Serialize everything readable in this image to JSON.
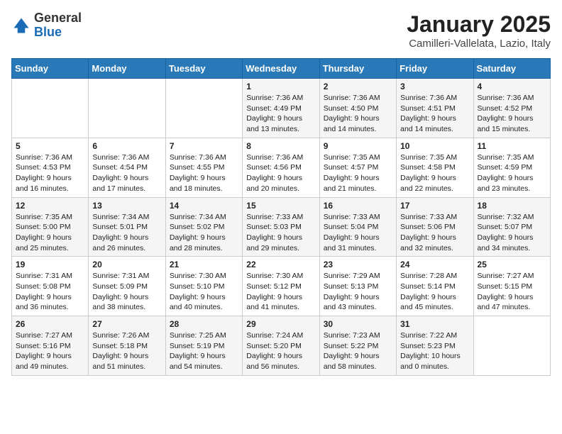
{
  "header": {
    "logo": {
      "general": "General",
      "blue": "Blue"
    },
    "title": "January 2025",
    "location": "Camilleri-Vallelata, Lazio, Italy"
  },
  "weekdays": [
    "Sunday",
    "Monday",
    "Tuesday",
    "Wednesday",
    "Thursday",
    "Friday",
    "Saturday"
  ],
  "weeks": [
    [
      {
        "day": "",
        "info": ""
      },
      {
        "day": "",
        "info": ""
      },
      {
        "day": "",
        "info": ""
      },
      {
        "day": "1",
        "info": "Sunrise: 7:36 AM\nSunset: 4:49 PM\nDaylight: 9 hours\nand 13 minutes."
      },
      {
        "day": "2",
        "info": "Sunrise: 7:36 AM\nSunset: 4:50 PM\nDaylight: 9 hours\nand 14 minutes."
      },
      {
        "day": "3",
        "info": "Sunrise: 7:36 AM\nSunset: 4:51 PM\nDaylight: 9 hours\nand 14 minutes."
      },
      {
        "day": "4",
        "info": "Sunrise: 7:36 AM\nSunset: 4:52 PM\nDaylight: 9 hours\nand 15 minutes."
      }
    ],
    [
      {
        "day": "5",
        "info": "Sunrise: 7:36 AM\nSunset: 4:53 PM\nDaylight: 9 hours\nand 16 minutes."
      },
      {
        "day": "6",
        "info": "Sunrise: 7:36 AM\nSunset: 4:54 PM\nDaylight: 9 hours\nand 17 minutes."
      },
      {
        "day": "7",
        "info": "Sunrise: 7:36 AM\nSunset: 4:55 PM\nDaylight: 9 hours\nand 18 minutes."
      },
      {
        "day": "8",
        "info": "Sunrise: 7:36 AM\nSunset: 4:56 PM\nDaylight: 9 hours\nand 20 minutes."
      },
      {
        "day": "9",
        "info": "Sunrise: 7:35 AM\nSunset: 4:57 PM\nDaylight: 9 hours\nand 21 minutes."
      },
      {
        "day": "10",
        "info": "Sunrise: 7:35 AM\nSunset: 4:58 PM\nDaylight: 9 hours\nand 22 minutes."
      },
      {
        "day": "11",
        "info": "Sunrise: 7:35 AM\nSunset: 4:59 PM\nDaylight: 9 hours\nand 23 minutes."
      }
    ],
    [
      {
        "day": "12",
        "info": "Sunrise: 7:35 AM\nSunset: 5:00 PM\nDaylight: 9 hours\nand 25 minutes."
      },
      {
        "day": "13",
        "info": "Sunrise: 7:34 AM\nSunset: 5:01 PM\nDaylight: 9 hours\nand 26 minutes."
      },
      {
        "day": "14",
        "info": "Sunrise: 7:34 AM\nSunset: 5:02 PM\nDaylight: 9 hours\nand 28 minutes."
      },
      {
        "day": "15",
        "info": "Sunrise: 7:33 AM\nSunset: 5:03 PM\nDaylight: 9 hours\nand 29 minutes."
      },
      {
        "day": "16",
        "info": "Sunrise: 7:33 AM\nSunset: 5:04 PM\nDaylight: 9 hours\nand 31 minutes."
      },
      {
        "day": "17",
        "info": "Sunrise: 7:33 AM\nSunset: 5:06 PM\nDaylight: 9 hours\nand 32 minutes."
      },
      {
        "day": "18",
        "info": "Sunrise: 7:32 AM\nSunset: 5:07 PM\nDaylight: 9 hours\nand 34 minutes."
      }
    ],
    [
      {
        "day": "19",
        "info": "Sunrise: 7:31 AM\nSunset: 5:08 PM\nDaylight: 9 hours\nand 36 minutes."
      },
      {
        "day": "20",
        "info": "Sunrise: 7:31 AM\nSunset: 5:09 PM\nDaylight: 9 hours\nand 38 minutes."
      },
      {
        "day": "21",
        "info": "Sunrise: 7:30 AM\nSunset: 5:10 PM\nDaylight: 9 hours\nand 40 minutes."
      },
      {
        "day": "22",
        "info": "Sunrise: 7:30 AM\nSunset: 5:12 PM\nDaylight: 9 hours\nand 41 minutes."
      },
      {
        "day": "23",
        "info": "Sunrise: 7:29 AM\nSunset: 5:13 PM\nDaylight: 9 hours\nand 43 minutes."
      },
      {
        "day": "24",
        "info": "Sunrise: 7:28 AM\nSunset: 5:14 PM\nDaylight: 9 hours\nand 45 minutes."
      },
      {
        "day": "25",
        "info": "Sunrise: 7:27 AM\nSunset: 5:15 PM\nDaylight: 9 hours\nand 47 minutes."
      }
    ],
    [
      {
        "day": "26",
        "info": "Sunrise: 7:27 AM\nSunset: 5:16 PM\nDaylight: 9 hours\nand 49 minutes."
      },
      {
        "day": "27",
        "info": "Sunrise: 7:26 AM\nSunset: 5:18 PM\nDaylight: 9 hours\nand 51 minutes."
      },
      {
        "day": "28",
        "info": "Sunrise: 7:25 AM\nSunset: 5:19 PM\nDaylight: 9 hours\nand 54 minutes."
      },
      {
        "day": "29",
        "info": "Sunrise: 7:24 AM\nSunset: 5:20 PM\nDaylight: 9 hours\nand 56 minutes."
      },
      {
        "day": "30",
        "info": "Sunrise: 7:23 AM\nSunset: 5:22 PM\nDaylight: 9 hours\nand 58 minutes."
      },
      {
        "day": "31",
        "info": "Sunrise: 7:22 AM\nSunset: 5:23 PM\nDaylight: 10 hours\nand 0 minutes."
      },
      {
        "day": "",
        "info": ""
      }
    ]
  ]
}
